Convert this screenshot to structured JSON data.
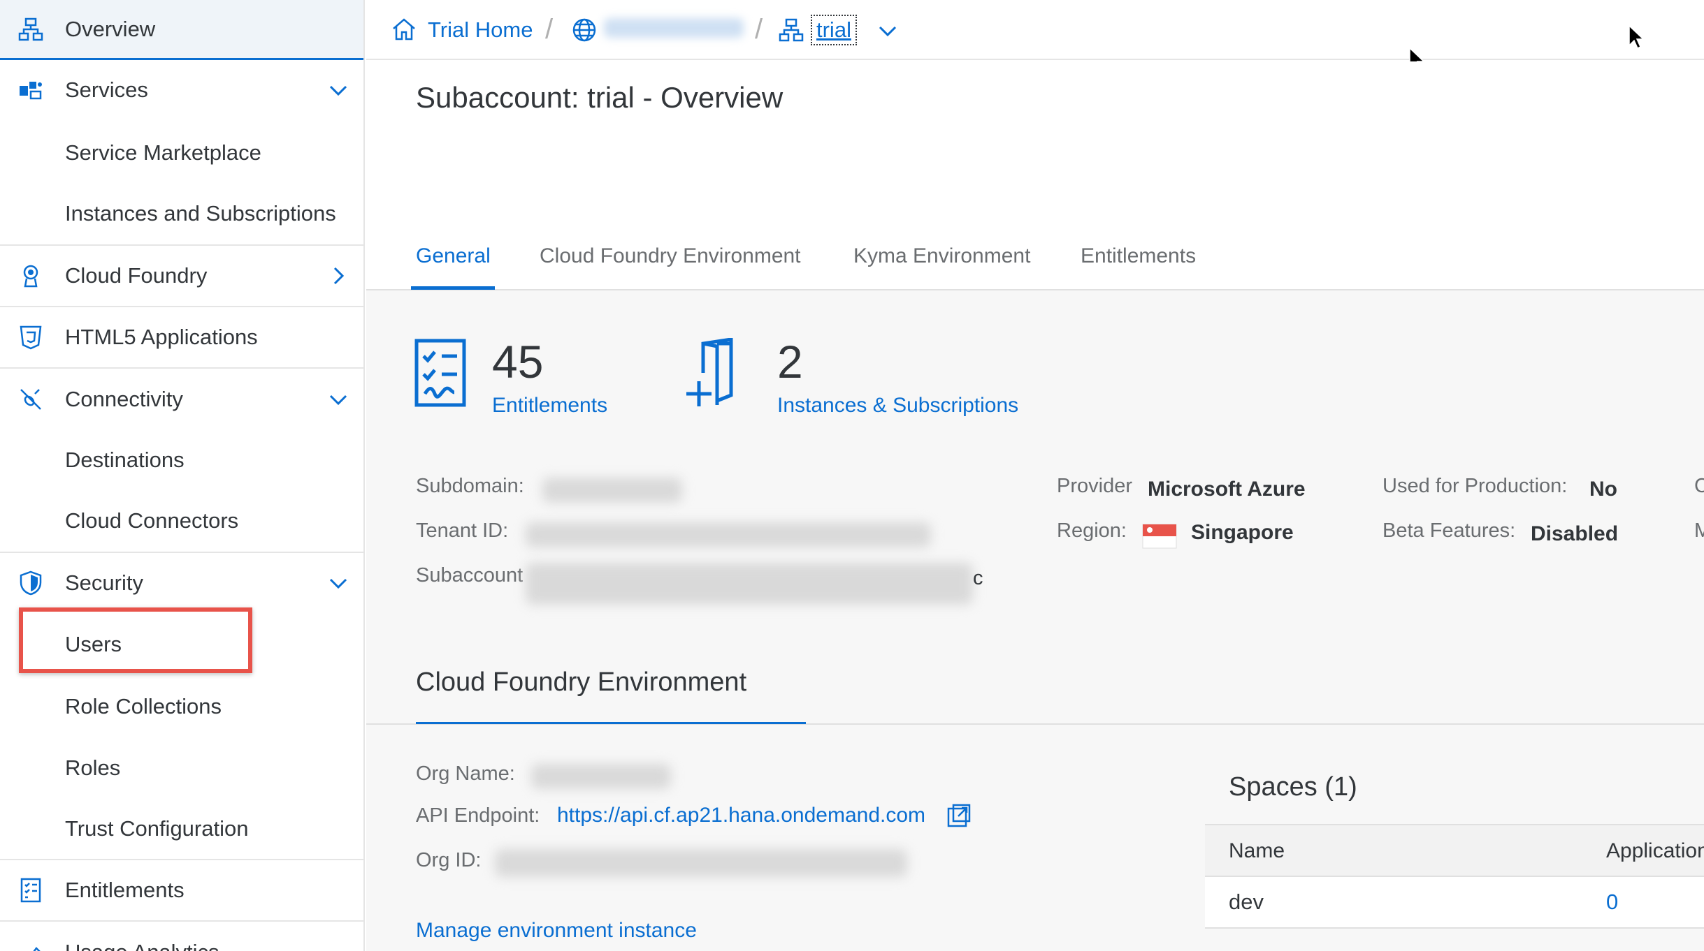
{
  "sidebar": {
    "items": [
      {
        "label": "Overview",
        "icon": "hierarchy-icon"
      },
      {
        "label": "Services",
        "icon": "services-puzzle-icon"
      },
      {
        "label": "Service Marketplace"
      },
      {
        "label": "Instances and Subscriptions"
      },
      {
        "label": "Cloud Foundry",
        "icon": "cloud-foundry-icon"
      },
      {
        "label": "HTML5 Applications",
        "icon": "html5-icon"
      },
      {
        "label": "Connectivity",
        "icon": "connectivity-icon"
      },
      {
        "label": "Destinations"
      },
      {
        "label": "Cloud Connectors"
      },
      {
        "label": "Security",
        "icon": "shield-icon"
      },
      {
        "label": "Users"
      },
      {
        "label": "Role Collections"
      },
      {
        "label": "Roles"
      },
      {
        "label": "Trust Configuration"
      },
      {
        "label": "Entitlements",
        "icon": "checklist-icon"
      },
      {
        "label": "Usage Analytics",
        "icon": "analytics-icon"
      }
    ]
  },
  "breadcrumb": {
    "home": "Trial Home",
    "subaccount": "trial"
  },
  "header": {
    "title": "Subaccount: trial - Overview",
    "tabs": [
      "General",
      "Cloud Foundry Environment",
      "Kyma Environment",
      "Entitlements"
    ],
    "active_tab": "General"
  },
  "kpis": {
    "entitlements": {
      "value": "45",
      "label": "Entitlements"
    },
    "instances": {
      "value": "2",
      "label": "Instances & Subscriptions"
    }
  },
  "details": {
    "subdomain_label": "Subdomain:",
    "tenant_label": "Tenant ID:",
    "subaccount_label": "Subaccount",
    "subaccount_suffix": "c",
    "provider_label": "Provider",
    "provider_value": "Microsoft Azure",
    "region_label": "Region:",
    "region_value": "Singapore",
    "production_label": "Used for Production:",
    "production_value": "No",
    "beta_label": "Beta Features:",
    "beta_value": "Disabled",
    "cut_col_1": "C",
    "cut_col_2": "M"
  },
  "cf": {
    "section_title": "Cloud Foundry Environment",
    "org_name_label": "Org Name:",
    "api_label": "API Endpoint:",
    "api_value": "https://api.cf.ap21.hana.ondemand.com",
    "org_id_label": "Org ID:",
    "manage_link": "Manage environment instance"
  },
  "spaces": {
    "title": "Spaces (1)",
    "columns": [
      "Name",
      "Application"
    ],
    "rows": [
      {
        "name": "dev",
        "apps": "0"
      }
    ]
  },
  "colors": {
    "accent": "#0a6ed1",
    "highlight": "#e8534a",
    "text": "#32363a",
    "muted": "#6a6d70"
  }
}
